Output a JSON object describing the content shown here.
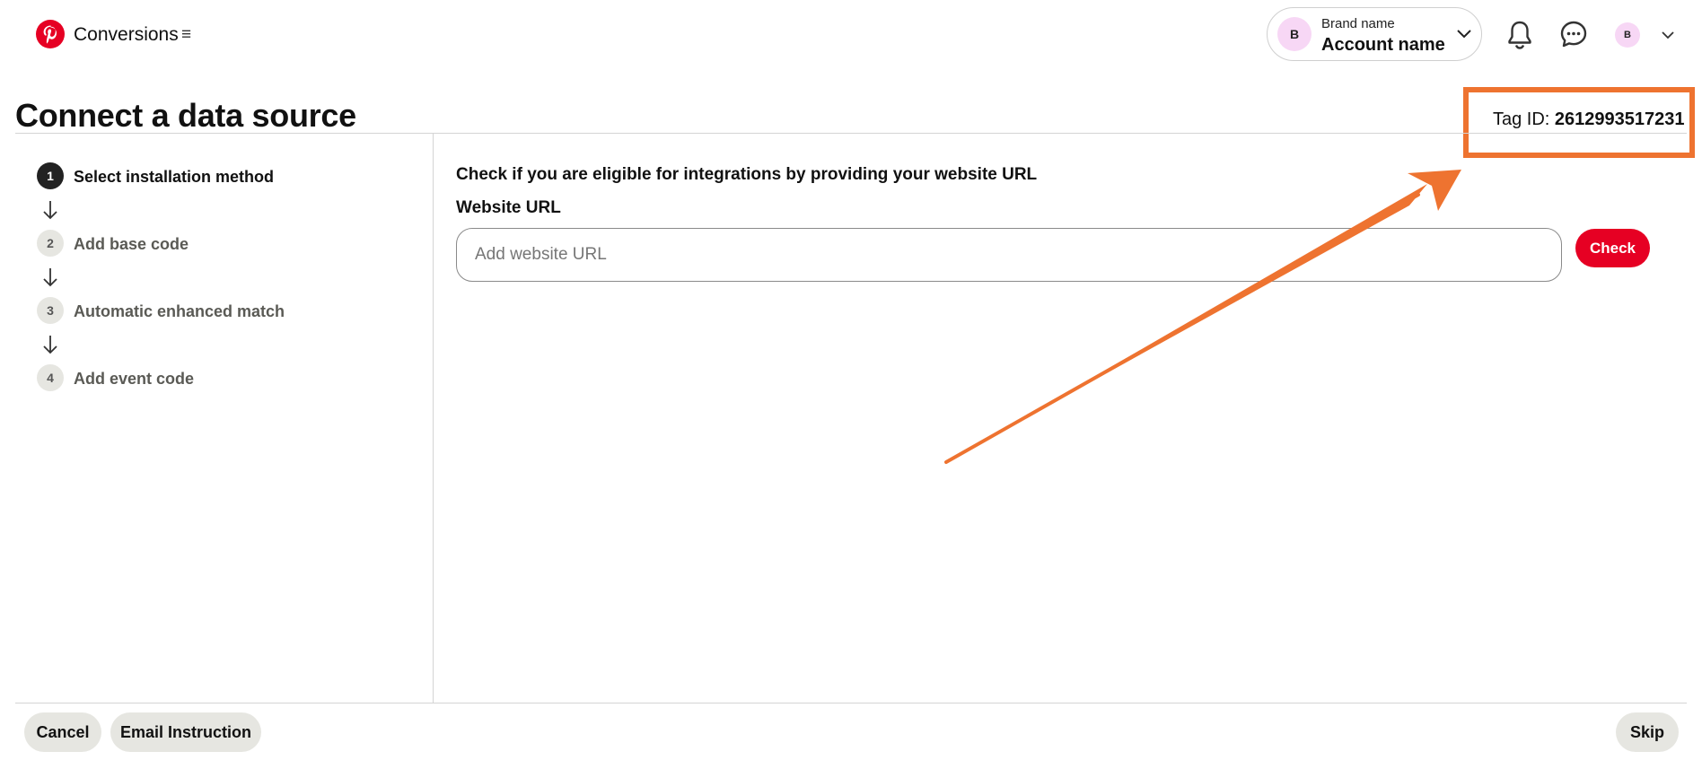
{
  "header": {
    "app_name": "Conversions",
    "account": {
      "avatar_initial": "B",
      "brand_label": "Brand name",
      "account_label": "Account name"
    },
    "user_avatar_initial": "B",
    "icons": [
      "pinterest-logo-icon",
      "menu-icon",
      "chevron-down-icon",
      "bell-icon",
      "chat-icon"
    ]
  },
  "page": {
    "title": "Connect a data source",
    "tag_id_label": "Tag ID:",
    "tag_id_value": "2612993517231"
  },
  "steps": [
    {
      "number": "1",
      "label": "Select installation method",
      "active": true
    },
    {
      "number": "2",
      "label": "Add base code",
      "active": false
    },
    {
      "number": "3",
      "label": "Automatic enhanced match",
      "active": false
    },
    {
      "number": "4",
      "label": "Add event code",
      "active": false
    }
  ],
  "main": {
    "eligibility_text": "Check if you are eligible for integrations by providing your website URL",
    "url_label": "Website URL",
    "url_placeholder": "Add website URL",
    "url_value": "",
    "check_label": "Check"
  },
  "footer": {
    "cancel_label": "Cancel",
    "email_label": "Email Instruction",
    "skip_label": "Skip"
  },
  "colors": {
    "brand_red": "#e60023",
    "annotation_orange": "#ee7330",
    "button_gray": "#e6e6e1",
    "avatar_pink": "#f7d7f5"
  }
}
